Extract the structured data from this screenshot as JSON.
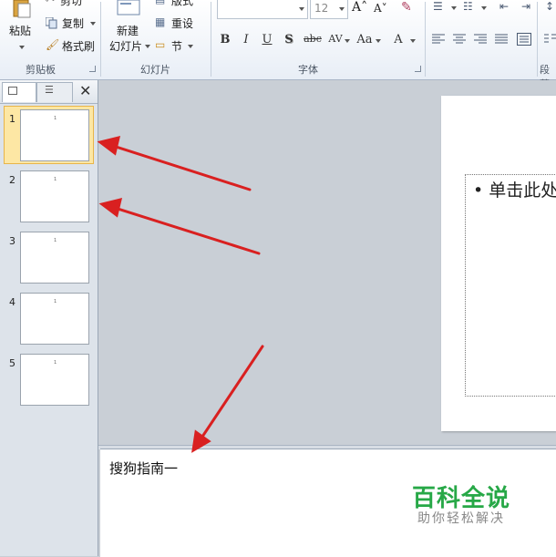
{
  "ribbon": {
    "clipboard": {
      "label": "剪贴板",
      "paste": "粘贴",
      "cut": "剪切",
      "copy": "复制",
      "format_painter": "格式刷"
    },
    "slides": {
      "label": "幻灯片",
      "new_slide_line1": "新建",
      "new_slide_line2": "幻灯片",
      "layout": "版式",
      "reset": "重设",
      "section": "节"
    },
    "font": {
      "label": "字体",
      "font_size": "12",
      "bold": "B",
      "italic": "I",
      "underline": "U",
      "shadow": "S",
      "strike": "abc",
      "spacing": "AV",
      "change_case": "Aa",
      "font_color": "A"
    },
    "paragraph": {
      "label": "段落"
    }
  },
  "slides_panel": {
    "slides": [
      {
        "number": "1",
        "marker": "1"
      },
      {
        "number": "2",
        "marker": "1"
      },
      {
        "number": "3",
        "marker": "1"
      },
      {
        "number": "4",
        "marker": "1"
      },
      {
        "number": "5",
        "marker": "1"
      }
    ],
    "selected_index": 0
  },
  "slide": {
    "placeholder_text": "• 单击此处"
  },
  "notes": {
    "text": "搜狗指南一"
  },
  "watermark": {
    "title": "百科全说",
    "subtitle": "助你轻松解决"
  },
  "annotations": {
    "arrow_color": "#d92020",
    "arrow_count": 3
  },
  "colors": {
    "selected_thumb_bg": "#fde7a4",
    "watermark_green": "#27a847"
  }
}
